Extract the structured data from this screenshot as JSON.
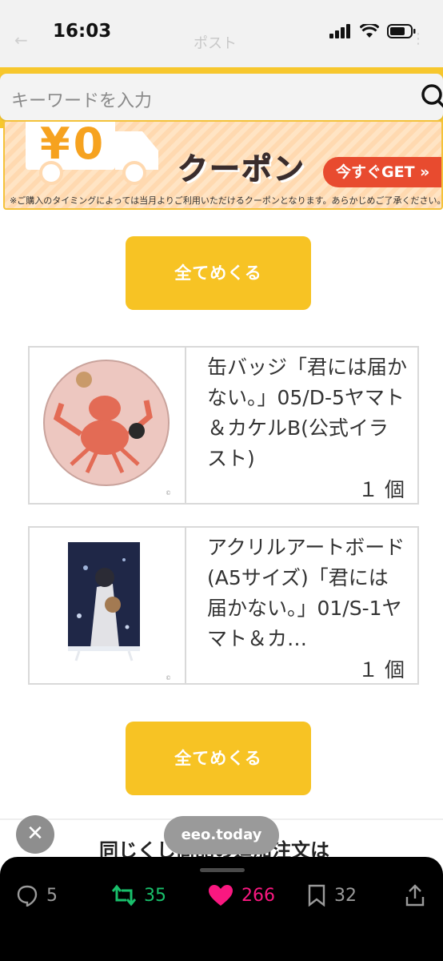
{
  "status_bar": {
    "time": "16:03",
    "ghost_title": "ポスト"
  },
  "search": {
    "placeholder": "キーワードを入力"
  },
  "banner": {
    "price": "¥0",
    "headline": "クーポン",
    "cta": "今すぐGET »",
    "note": "※ご購入のタイミングによっては当月よりご利用いただけるクーポンとなります。あらかじめご了承ください。"
  },
  "buttons": {
    "see_all_1": "全てめくる",
    "see_all_2": "全てめくる"
  },
  "products": [
    {
      "title": "缶バッジ「君には届かない。」05/D-5ヤマト＆カケルB(公式イラスト)",
      "qty": "１ 個"
    },
    {
      "title": "アクリルアートボード(A5サイズ)「君には届かない。」01/S-1ヤマト＆カ…",
      "qty": "１ 個"
    }
  ],
  "next_heading": "同じくじ商品の追加注文は",
  "url_pill": "eeo.today",
  "actions": {
    "replies": "5",
    "reposts": "35",
    "likes": "266",
    "bookmarks": "32"
  },
  "colors": {
    "accent": "#f7c324",
    "repost": "#19bf6b",
    "like": "#f91880",
    "cta": "#e84b2f"
  }
}
